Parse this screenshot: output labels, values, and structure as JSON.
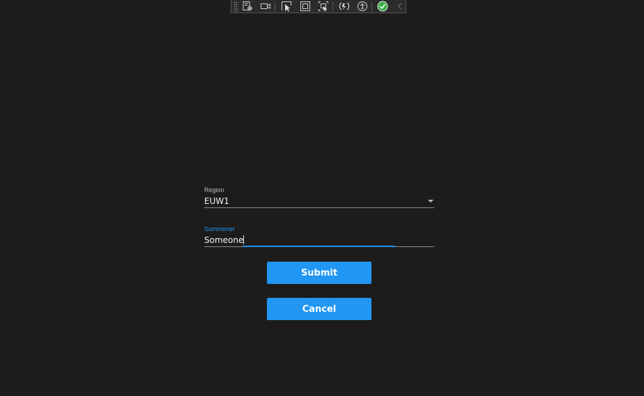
{
  "toolbar": {
    "buttons": [
      {
        "icon": "live-visual-tree-icon"
      },
      {
        "icon": "record-icon"
      },
      {
        "icon": "select-element-icon"
      },
      {
        "icon": "display-layout-adorners-icon"
      },
      {
        "icon": "track-focused-element-icon"
      },
      {
        "icon": "hot-reload-icon"
      },
      {
        "icon": "accessibility-icon"
      },
      {
        "icon": "check-status-icon"
      },
      {
        "icon": "collapse-chevron-icon"
      }
    ]
  },
  "form": {
    "region": {
      "label": "Region",
      "value": "EUW1"
    },
    "summoner": {
      "label": "Summoner",
      "value": "Someone"
    },
    "submit_label": "Submit",
    "cancel_label": "Cancel"
  },
  "colors": {
    "background": "#1c1c1c",
    "accent": "#2196f3",
    "toolbar_bg": "#2b2b2b",
    "status_green": "#3fae49"
  }
}
